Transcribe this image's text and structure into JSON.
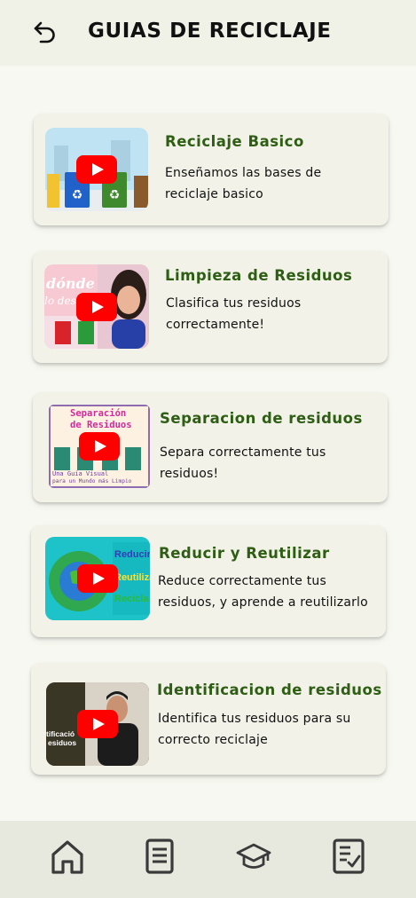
{
  "header": {
    "title": "GUIAS DE RECICLAJE"
  },
  "guides": [
    {
      "title": "Reciclaje Basico",
      "description": "Enseñamos las bases de reciclaje basico"
    },
    {
      "title": "Limpieza de Residuos",
      "description": "Clasifica tus residuos correctamente!"
    },
    {
      "title": "Separacion de residuos",
      "description": "Separa correctamente tus residuos!",
      "thumb_text": [
        "Separación",
        "de Residuos",
        "Una Guía Visual",
        "para un Mundo más Limpio"
      ]
    },
    {
      "title": "Reducir y Reutilizar",
      "description": "Reduce correctamente tus residuos, y aprende a reutilizarlo",
      "thumb_text": [
        "Reducir",
        "Reutiliza",
        "Recicla"
      ]
    },
    {
      "title": "Identificacion de residuos",
      "description": "Identifica tus residuos para su correcto reciclaje",
      "thumb_text": [
        "tificació",
        "esiduos"
      ]
    }
  ],
  "thumb2_text": [
    "dónde",
    "lo dese"
  ],
  "colors": {
    "accent": "#2e5d14",
    "header_bg": "#f0f1e7",
    "card_bg": "#f2f2e8",
    "nav_bg": "#e8e9de",
    "play_red": "#ff0000"
  },
  "icons": {
    "back": "back-arrow-icon",
    "nav": [
      "home-icon",
      "document-icon",
      "graduation-cap-icon",
      "checklist-icon"
    ]
  }
}
